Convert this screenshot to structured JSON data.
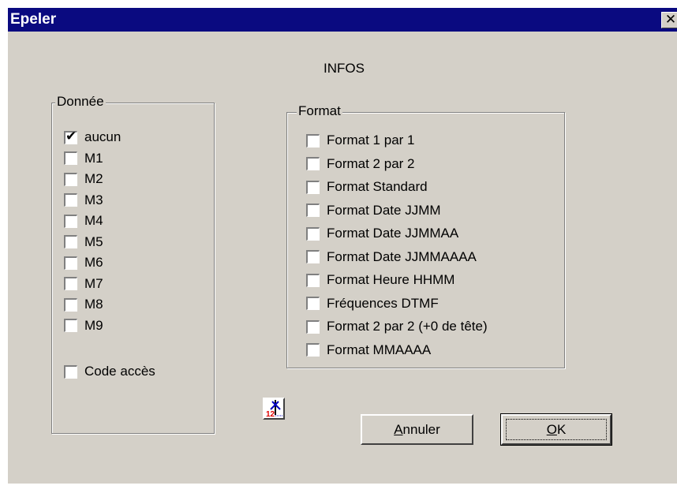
{
  "window": {
    "title": "Epeler",
    "close_glyph": "✕"
  },
  "info_label": "INFOS",
  "donnee": {
    "legend": "Donnée",
    "items": [
      {
        "label": "aucun",
        "checked": true
      },
      {
        "label": "M1",
        "checked": false
      },
      {
        "label": "M2",
        "checked": false
      },
      {
        "label": "M3",
        "checked": false
      },
      {
        "label": "M4",
        "checked": false
      },
      {
        "label": "M5",
        "checked": false
      },
      {
        "label": "M6",
        "checked": false
      },
      {
        "label": "M7",
        "checked": false
      },
      {
        "label": "M8",
        "checked": false
      },
      {
        "label": "M9",
        "checked": false
      }
    ],
    "code_acces": {
      "label": "Code accès",
      "checked": false
    }
  },
  "format": {
    "legend": "Format",
    "items": [
      {
        "label": "Format 1 par 1",
        "checked": false
      },
      {
        "label": "Format 2 par 2",
        "checked": false
      },
      {
        "label": "Format Standard",
        "checked": false
      },
      {
        "label": "Format Date JJMM",
        "checked": false
      },
      {
        "label": "Format Date JJMMAA",
        "checked": false
      },
      {
        "label": "Format Date JJMMAAAA",
        "checked": false
      },
      {
        "label": "Format Heure HHMM",
        "checked": false
      },
      {
        "label": "Fréquences DTMF",
        "checked": false
      },
      {
        "label": "Format 2 par 2 (+0 de tête)",
        "checked": false
      },
      {
        "label": "Format MMAAAA",
        "checked": false
      }
    ]
  },
  "icon_button": {
    "icon": "numbers-edit-icon",
    "glyph": "12"
  },
  "buttons": {
    "cancel": {
      "mnemonic": "A",
      "rest": "nnuler"
    },
    "ok": {
      "mnemonic": "O",
      "rest": "K"
    }
  }
}
